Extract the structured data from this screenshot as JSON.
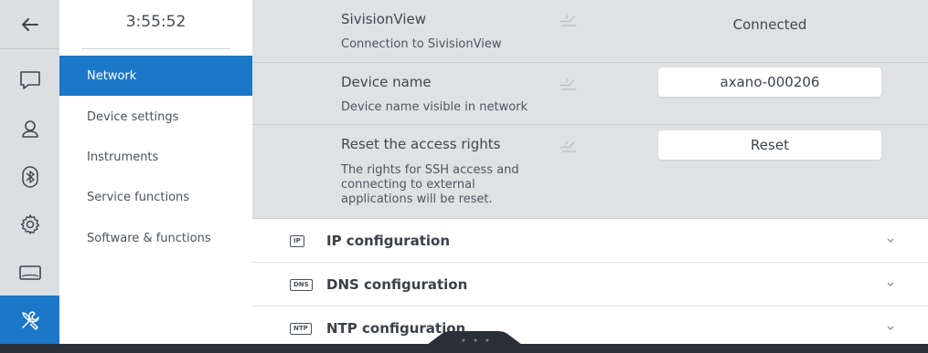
{
  "clock": "3:55:52",
  "rail": {
    "icons": [
      "back-arrow-icon",
      "chat-icon",
      "user-icon",
      "bluetooth-icon",
      "gear-icon",
      "display-icon",
      "tools-icon"
    ]
  },
  "nav": {
    "items": [
      {
        "label": "Network"
      },
      {
        "label": "Device settings"
      },
      {
        "label": "Instruments"
      },
      {
        "label": "Service functions"
      },
      {
        "label": "Software & functions"
      }
    ]
  },
  "settings": {
    "sivision": {
      "title": "SivisionView",
      "desc": "Connection to SivisionView",
      "value": "Connected"
    },
    "device_name": {
      "title": "Device name",
      "desc": "Device name visible in network",
      "value": "axano-000206"
    },
    "reset": {
      "title": "Reset the access rights",
      "desc": "The rights for SSH access and connecting to external applications will be reset.",
      "button": "Reset"
    }
  },
  "sections": [
    {
      "tag": "IP",
      "title": "IP configuration"
    },
    {
      "tag": "DNS",
      "title": "DNS configuration"
    },
    {
      "tag": "NTP",
      "title": "NTP configuration"
    }
  ],
  "colors": {
    "accent": "#1b78c8",
    "rail_bg": "#dcdfe2",
    "setting_bg": "#dfe1e3",
    "bottom_bar": "#2a3037"
  }
}
